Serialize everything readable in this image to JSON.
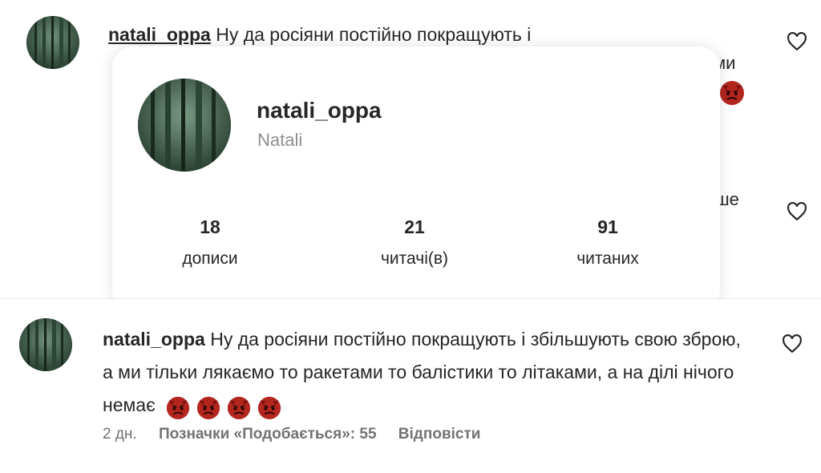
{
  "top_comment": {
    "username": "natali_oppa",
    "text_start": "Ну да росіяни постійно покращують і",
    "cut_text_line2_end": "ми",
    "cut_text_line3_end": "ше"
  },
  "profile_card": {
    "username": "natali_oppa",
    "full_name": "Natali",
    "stats": [
      {
        "value": "18",
        "label": "дописи"
      },
      {
        "value": "21",
        "label": "читачі(в)"
      },
      {
        "value": "91",
        "label": "читаних"
      }
    ]
  },
  "bottom_comment": {
    "username": "natali_oppa",
    "text": "Ну да росіяни постійно покращують і збільшують свою зброю, а ми тільки лякаємо то ракетами то балістики то літаками, а на ділі нічого немає",
    "emoji_count": 4,
    "time": "2 дн.",
    "likes": "Позначки «Подобається»: 55",
    "reply": "Відповісти"
  },
  "icons": {
    "like": "heart-outline-icon",
    "emoji": "angry-devil-emoji"
  },
  "colors": {
    "text": "#262626",
    "secondary": "#737373",
    "fullname": "#8e8e8e",
    "emoji_red": "#b3261e"
  }
}
